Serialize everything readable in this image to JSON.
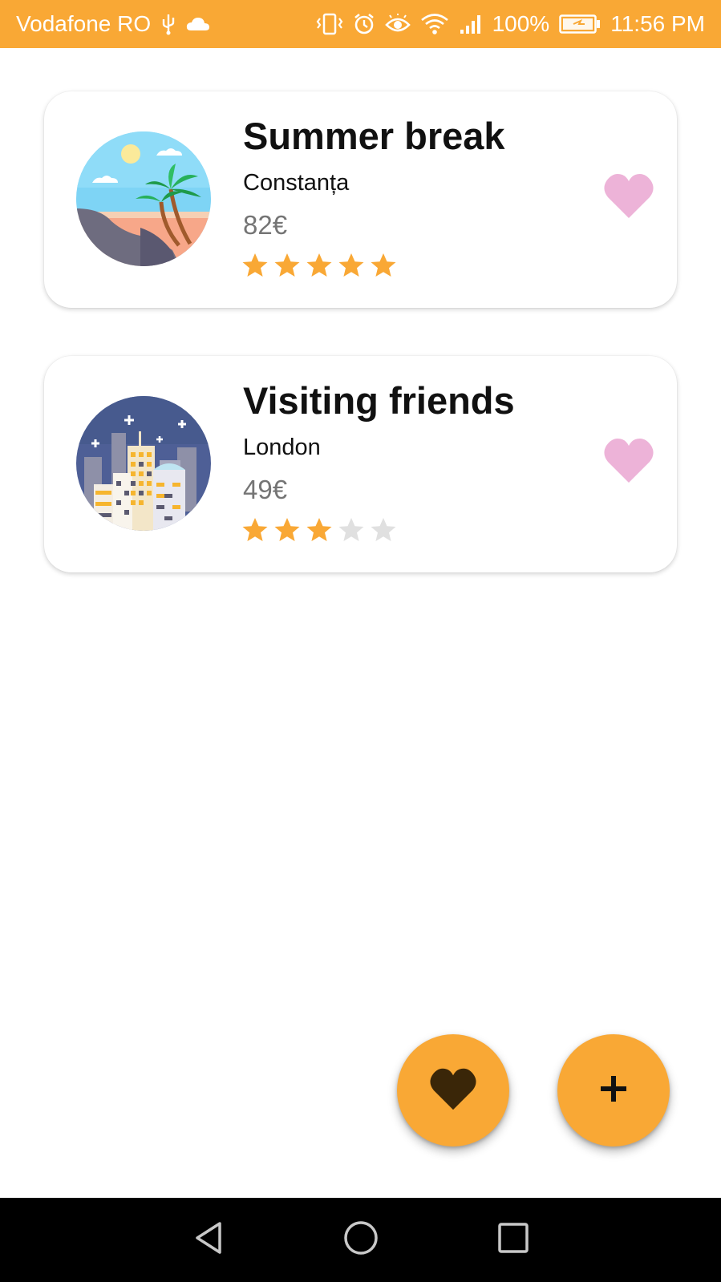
{
  "status_bar": {
    "carrier": "Vodafone RO",
    "battery": "100%",
    "time": "11:56 PM",
    "icons": [
      "usb-icon",
      "cloud-icon",
      "vibrate-icon",
      "alarm-icon",
      "eye-icon",
      "wifi-icon",
      "signal-icon",
      "battery-charging-icon"
    ]
  },
  "trips": [
    {
      "title": "Summer break",
      "location": "Constanța",
      "price": "82€",
      "rating": 5,
      "max_rating": 5,
      "image": "beach-palm-icon",
      "favorite_icon": "heart-icon"
    },
    {
      "title": "Visiting friends",
      "location": "London",
      "price": "49€",
      "rating": 3,
      "max_rating": 5,
      "image": "city-night-icon",
      "favorite_icon": "heart-icon"
    }
  ],
  "fabs": {
    "favorites_icon": "heart-icon",
    "add_icon": "plus-icon"
  },
  "nav": {
    "icons": [
      "back-icon",
      "home-icon",
      "recents-icon"
    ]
  },
  "colors": {
    "accent": "#F9A835",
    "star_filled": "#F9A835",
    "star_empty": "#E0E0E0",
    "favorite_heart": "#EDB3D8",
    "fab_heart": "#3A2608"
  }
}
